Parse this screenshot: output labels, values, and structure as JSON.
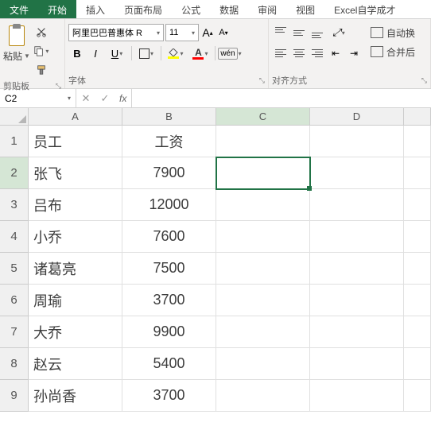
{
  "menu": {
    "file": "文件",
    "home": "开始",
    "insert": "插入",
    "pagelayout": "页面布局",
    "formulas": "公式",
    "data": "数据",
    "review": "审阅",
    "view": "视图",
    "extra": "Excel自学成才"
  },
  "ribbon": {
    "clipboard": {
      "paste": "粘贴",
      "label": "剪贴板"
    },
    "font": {
      "name": "阿里巴巴普惠体 R",
      "size": "11",
      "bold": "B",
      "italic": "I",
      "underline": "U",
      "grow": "A",
      "shrink": "A",
      "char_a": "A",
      "wen": "wén",
      "label": "字体"
    },
    "align": {
      "wrap": "自动换",
      "merge": "合并后",
      "label": "对齐方式"
    }
  },
  "namebox": "C2",
  "fx": "fx",
  "columns": [
    "A",
    "B",
    "C",
    "D",
    ""
  ],
  "chart_data": {
    "type": "table",
    "title": "",
    "headers": [
      "员工",
      "工资"
    ],
    "rows": [
      {
        "员工": "张飞",
        "工资": 7900
      },
      {
        "员工": "吕布",
        "工资": 12000
      },
      {
        "员工": "小乔",
        "工资": 7600
      },
      {
        "员工": "诸葛亮",
        "工资": 7500
      },
      {
        "员工": "周瑜",
        "工资": 3700
      },
      {
        "员工": "大乔",
        "工资": 9900
      },
      {
        "员工": "赵云",
        "工资": 5400
      },
      {
        "员工": "孙尚香",
        "工资": 3700
      }
    ]
  },
  "selected_cell": "C2"
}
